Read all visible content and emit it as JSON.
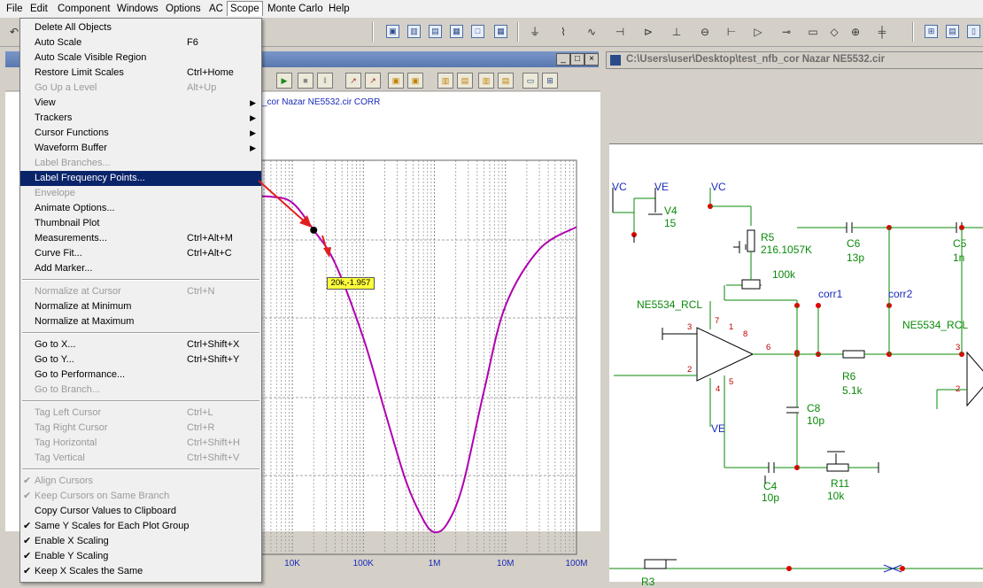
{
  "menubar": [
    "File",
    "Edit",
    "Component",
    "Windows",
    "Options",
    "AC",
    "Scope",
    "Monte Carlo",
    "Help"
  ],
  "active_menu": "Scope",
  "menu": {
    "items": [
      {
        "label": "Delete All Objects",
        "shortcut": "",
        "enabled": true
      },
      {
        "label": "Auto Scale",
        "shortcut": "F6",
        "enabled": true
      },
      {
        "label": "Auto Scale Visible Region",
        "shortcut": "",
        "enabled": true
      },
      {
        "label": "Restore Limit Scales",
        "shortcut": "Ctrl+Home",
        "enabled": true
      },
      {
        "label": "Go Up a Level",
        "shortcut": "Alt+Up",
        "enabled": false
      },
      {
        "label": "View",
        "shortcut": "",
        "enabled": true,
        "submenu": true
      },
      {
        "label": "Trackers",
        "shortcut": "",
        "enabled": true,
        "submenu": true
      },
      {
        "label": "Cursor Functions",
        "shortcut": "",
        "enabled": true,
        "submenu": true
      },
      {
        "label": "Waveform Buffer",
        "shortcut": "",
        "enabled": true,
        "submenu": true
      },
      {
        "label": "Label Branches...",
        "shortcut": "",
        "enabled": false
      },
      {
        "label": "Label Frequency Points...",
        "shortcut": "",
        "enabled": true,
        "highlighted": true
      },
      {
        "label": "Envelope",
        "shortcut": "",
        "enabled": false
      },
      {
        "label": "Animate Options...",
        "shortcut": "",
        "enabled": true
      },
      {
        "label": "Thumbnail Plot",
        "shortcut": "",
        "enabled": true
      },
      {
        "label": "Measurements...",
        "shortcut": "Ctrl+Alt+M",
        "enabled": true
      },
      {
        "label": "Curve Fit...",
        "shortcut": "Ctrl+Alt+C",
        "enabled": true
      },
      {
        "label": "Add Marker...",
        "shortcut": "",
        "enabled": true
      },
      {
        "separator": true
      },
      {
        "label": "Normalize at Cursor",
        "shortcut": "Ctrl+N",
        "enabled": false
      },
      {
        "label": "Normalize at Minimum",
        "shortcut": "",
        "enabled": true
      },
      {
        "label": "Normalize at Maximum",
        "shortcut": "",
        "enabled": true
      },
      {
        "separator": true
      },
      {
        "label": "Go to X...",
        "shortcut": "Ctrl+Shift+X",
        "enabled": true
      },
      {
        "label": "Go to Y...",
        "shortcut": "Ctrl+Shift+Y",
        "enabled": true
      },
      {
        "label": "Go to Performance...",
        "shortcut": "",
        "enabled": true
      },
      {
        "label": "Go to Branch...",
        "shortcut": "",
        "enabled": false
      },
      {
        "separator": true
      },
      {
        "label": "Tag Left Cursor",
        "shortcut": "Ctrl+L",
        "enabled": false
      },
      {
        "label": "Tag Right Cursor",
        "shortcut": "Ctrl+R",
        "enabled": false
      },
      {
        "label": "Tag Horizontal",
        "shortcut": "Ctrl+Shift+H",
        "enabled": false
      },
      {
        "label": "Tag Vertical",
        "shortcut": "Ctrl+Shift+V",
        "enabled": false
      },
      {
        "separator": true
      },
      {
        "label": "Align Cursors",
        "shortcut": "",
        "enabled": false,
        "checked": true
      },
      {
        "label": "Keep Cursors on Same Branch",
        "shortcut": "",
        "enabled": false,
        "checked": true
      },
      {
        "label": "Copy Cursor Values to Clipboard",
        "shortcut": "",
        "enabled": true
      },
      {
        "label": "Same Y Scales for Each Plot Group",
        "shortcut": "",
        "enabled": true,
        "checked": true
      },
      {
        "label": "Enable X Scaling",
        "shortcut": "",
        "enabled": true,
        "checked": true
      },
      {
        "label": "Enable Y Scaling",
        "shortcut": "",
        "enabled": true,
        "checked": true
      },
      {
        "label": "Keep X Scales the Same",
        "shortcut": "",
        "enabled": true,
        "checked": true
      }
    ]
  },
  "plot": {
    "title_fragment": "_cor Nazar NE5532.cir CORR",
    "cursor_label": "20k,-1.957",
    "trace_color": "#b000b0"
  },
  "chart_data": {
    "type": "line",
    "x_scale": "log",
    "x_ticks": [
      "10K",
      "100K",
      "1M",
      "10M",
      "100M"
    ],
    "series": [
      {
        "x": [
          2000,
          5000,
          10000,
          20000,
          40000,
          100000,
          200000,
          400000,
          700000,
          1000000,
          1500000,
          2500000,
          5000000,
          10000000,
          30000000,
          100000000
        ],
        "y": [
          -0.3,
          -0.3,
          -0.6,
          -1.957,
          -3.6,
          -7.3,
          -10.9,
          -14.4,
          -16.3,
          -16.9,
          -16.5,
          -14.6,
          -9.9,
          -5.7,
          -2.9,
          -1.8
        ]
      }
    ]
  },
  "schematic": {
    "window_title": "C:\\Users\\user\\Desktop\\test_nfb_cor Nazar NE5532.cir",
    "labels": {
      "vc1": "VC",
      "ve1": "VE",
      "v4": "V4",
      "v4v": "15",
      "vc2": "VC",
      "r5": "R5",
      "r5v": "216.1057K",
      "pot": "100k",
      "c6": "C6",
      "c6v": "13p",
      "c5": "C5",
      "c5v": "1n",
      "corr1": "corr1",
      "corr2": "corr2",
      "opamp1": "NE5534_RCL",
      "opamp2": "NE5534_RCL",
      "r6": "R6",
      "r6v": "5.1k",
      "c8": "C8",
      "c8v": "10p",
      "ve2": "VE",
      "c4": "C4",
      "c4v": "10p",
      "r11": "R11",
      "r11v": "10k",
      "r3": "R3",
      "p1": "1",
      "p2": "2",
      "p3": "3",
      "p4": "4",
      "p5": "5",
      "p6": "6",
      "p7": "7",
      "p8": "8",
      "q2": "2",
      "q3": "3"
    }
  }
}
